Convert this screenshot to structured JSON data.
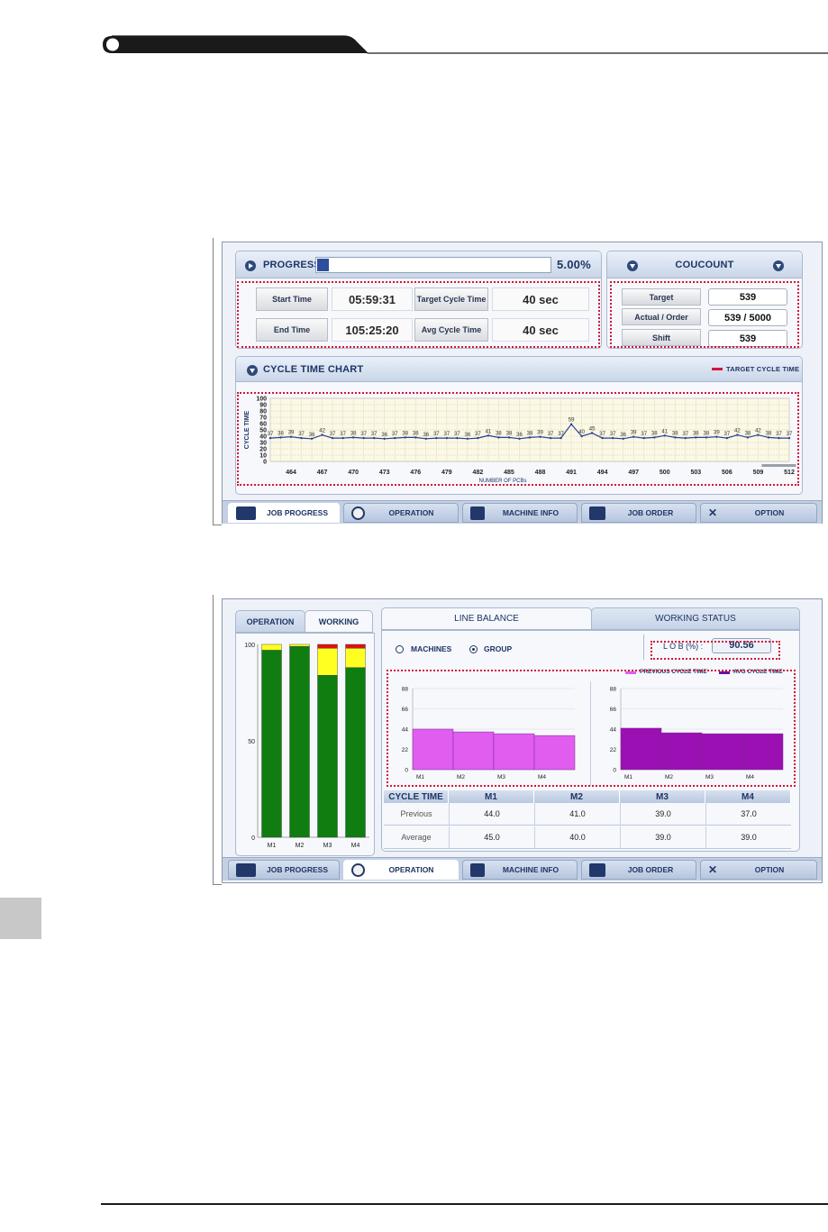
{
  "screen1": {
    "progress": {
      "title": "PROGRESS",
      "percent_text": "5.00%",
      "fraction": 0.05
    },
    "times": {
      "start_label": "Start Time",
      "start_value": "05:59:31",
      "end_label": "End Time",
      "end_value": "105:25:20",
      "target_label": "Target Cycle Time",
      "target_value": "40 sec",
      "avg_label": "Avg Cycle Time",
      "avg_value": "40 sec"
    },
    "count": {
      "title": "COUCOUNT",
      "target_label": "Target",
      "target_value": "539",
      "actual_label": "Actual / Order",
      "actual_value": "539 / 5000",
      "shift_label": "Shift",
      "shift_value": "539"
    },
    "chart_panel": {
      "title": "CYCLE TIME CHART",
      "legend": "TARGET CYCLE TIME",
      "legend_color": "#d3163b"
    },
    "nav": [
      "JOB PROGRESS",
      "OPERATION",
      "MACHINE INFO",
      "JOB ORDER",
      "OPTION"
    ]
  },
  "screen2": {
    "left_tabs": [
      "OPERATION",
      "WORKING"
    ],
    "right_tabs": [
      "LINE BALANCE",
      "WORKING STATUS"
    ],
    "radio_machines": "MACHINES",
    "radio_group": "GROUP",
    "lob_label": "L O B (%) :",
    "lob_value": "90.56",
    "legend_previous": "PREVIOUS CYCLE TIME",
    "legend_avg": "AVG CYCLE TIME",
    "table": {
      "header": [
        "CYCLE TIME",
        "M1",
        "M2",
        "M3",
        "M4"
      ],
      "rows": [
        {
          "label": "Previous",
          "values": [
            "44.0",
            "41.0",
            "39.0",
            "37.0"
          ]
        },
        {
          "label": "Average",
          "values": [
            "45.0",
            "40.0",
            "39.0",
            "39.0"
          ]
        }
      ]
    },
    "nav": [
      "JOB PROGRESS",
      "OPERATION",
      "MACHINE INFO",
      "JOB ORDER",
      "OPTION"
    ]
  },
  "chart_data": [
    {
      "type": "line",
      "ylabel": "CYCLE TIME",
      "xlabel": "NUMBER OF PCBs",
      "ylim": [
        0,
        100
      ],
      "yticks": [
        0,
        10,
        20,
        30,
        40,
        50,
        60,
        70,
        80,
        90,
        100
      ],
      "xticks": [
        464,
        467,
        470,
        473,
        476,
        479,
        482,
        485,
        488,
        491,
        494,
        497,
        500,
        503,
        506,
        509,
        512
      ],
      "x": [
        462,
        463,
        464,
        465,
        466,
        467,
        468,
        469,
        470,
        471,
        472,
        473,
        474,
        475,
        476,
        477,
        478,
        479,
        480,
        481,
        482,
        483,
        484,
        485,
        486,
        487,
        488,
        489,
        490,
        491,
        492,
        493,
        494,
        495,
        496,
        497,
        498,
        499,
        500,
        501,
        502,
        503,
        504,
        505,
        506,
        507,
        508,
        509,
        510,
        511,
        512
      ],
      "series": [
        {
          "values": [
            37,
            38,
            39,
            37,
            36,
            42,
            37,
            37,
            38,
            37,
            37,
            36,
            37,
            38,
            38,
            36,
            37,
            37,
            37,
            36,
            37,
            41,
            38,
            38,
            36,
            38,
            39,
            37,
            37,
            59,
            40,
            45,
            37,
            37,
            36,
            39,
            37,
            38,
            41,
            38,
            37,
            38,
            38,
            39,
            37,
            42,
            38,
            42,
            38,
            37,
            37
          ]
        }
      ]
    },
    {
      "type": "bar",
      "stacked": true,
      "categories": [
        "M1",
        "M2",
        "M3",
        "M4"
      ],
      "ylim": [
        0,
        100
      ],
      "yticks": [
        0,
        50,
        100
      ],
      "series": [
        {
          "color": "#0f7d0f",
          "values": [
            97,
            99,
            84,
            88
          ]
        },
        {
          "color": "#ffff22",
          "values": [
            3,
            1,
            14,
            10
          ]
        },
        {
          "color": "#dd1111",
          "values": [
            0,
            0,
            2,
            2
          ]
        }
      ]
    },
    {
      "type": "bar",
      "series_name": "PREVIOUS CYCLE TIME",
      "categories": [
        "M1",
        "M2",
        "M3",
        "M4"
      ],
      "values": [
        44,
        41,
        39,
        37
      ],
      "ylim": [
        0,
        88
      ],
      "yticks": [
        0,
        22,
        44,
        66,
        88
      ],
      "color": "#e05df0"
    },
    {
      "type": "bar",
      "series_name": "AVG CYCLE TIME",
      "categories": [
        "M1",
        "M2",
        "M3",
        "M4"
      ],
      "values": [
        45,
        40,
        39,
        39
      ],
      "ylim": [
        0,
        88
      ],
      "yticks": [
        0,
        22,
        44,
        66,
        88
      ],
      "color": "#9a10b3"
    }
  ]
}
